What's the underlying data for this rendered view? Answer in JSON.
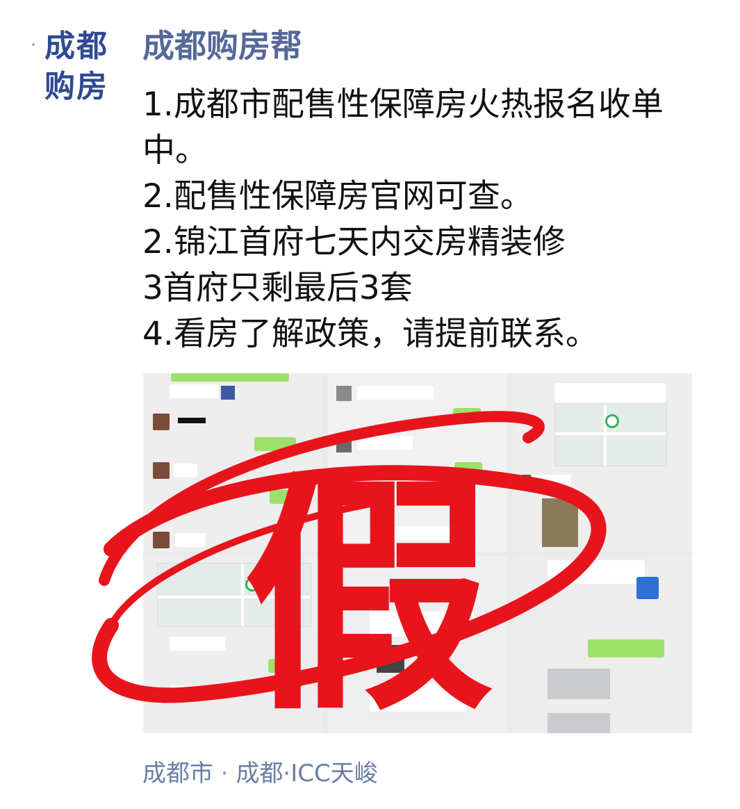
{
  "avatar": {
    "line1": "成都",
    "line2": "购房"
  },
  "post": {
    "author": "成都购房帮",
    "lines": [
      "1.成都市配售性保障房火热报名收单",
      "中。",
      "2.配售性保障房官网可查。",
      "2.锦江首府七天内交房精装修",
      "3首府只剩最后3套",
      "4.看房了解政策，请提前联系。"
    ],
    "stamp_text": "假",
    "location_prefix": "成都市",
    "location_sep": " · ",
    "location_suffix": "成都·ICC天峻"
  },
  "colors": {
    "stamp_red": "#e8141c",
    "name_blue": "#55689a",
    "avatar_blue": "#2f4a93",
    "location_blue": "#6a7da6"
  }
}
